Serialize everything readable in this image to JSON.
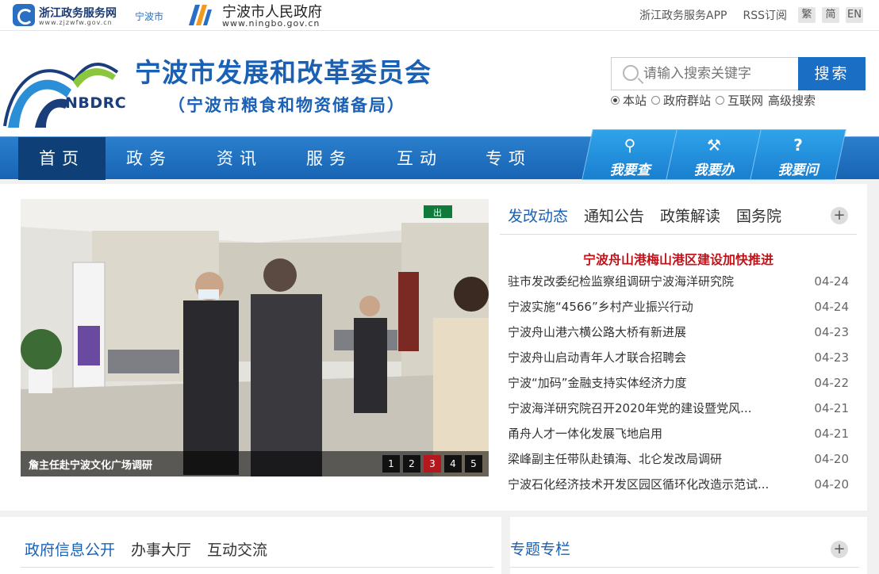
{
  "topbar": {
    "zj_title": "浙江政务服务网",
    "zj_url": "www.zjzwfw.gov.cn",
    "zj_city": "宁波市",
    "nb_title": "宁波市人民政府",
    "nb_url": "www.ningbo.gov.cn",
    "links": [
      "浙江政务服务APP",
      "RSS订阅"
    ],
    "langs": [
      "繁",
      "简",
      "EN"
    ]
  },
  "header": {
    "brand": "NBDRC",
    "title": "宁波市发展和改革委员会",
    "subtitle": "（宁波市粮食和物资储备局）",
    "search_placeholder": "请输入搜索关键字",
    "search_button": "搜索",
    "search_options": [
      "本站",
      "政府群站",
      "互联网"
    ],
    "advanced": "高级搜索"
  },
  "nav": {
    "items": [
      "首页",
      "政务",
      "资讯",
      "服务",
      "互动",
      "专项"
    ],
    "quick": [
      {
        "label": "我要查",
        "icon": "search-icon",
        "glyph": "🔍"
      },
      {
        "label": "我要办",
        "icon": "worker-icon",
        "glyph": "⚒"
      },
      {
        "label": "我要问",
        "icon": "question-icon",
        "glyph": "?"
      }
    ]
  },
  "slider": {
    "caption": "詹主任赴宁波文化广场调研",
    "pages": [
      "1",
      "2",
      "3",
      "4",
      "5"
    ],
    "active_page": "3",
    "exit_sign": "出"
  },
  "news": {
    "tabs": [
      "发改动态",
      "通知公告",
      "政策解读",
      "国务院"
    ],
    "more": "+",
    "headline": "宁波舟山港梅山港区建设加快推进",
    "items": [
      {
        "title": "驻市发改委纪检监察组调研宁波海洋研究院",
        "date": "04-24"
      },
      {
        "title": "宁波实施“4566”乡村产业振兴行动",
        "date": "04-24"
      },
      {
        "title": "宁波舟山港六横公路大桥有新进展",
        "date": "04-23"
      },
      {
        "title": "宁波舟山启动青年人才联合招聘会",
        "date": "04-23"
      },
      {
        "title": "宁波“加码”金融支持实体经济力度",
        "date": "04-22"
      },
      {
        "title": "宁波海洋研究院召开2020年党的建设暨党风...",
        "date": "04-21"
      },
      {
        "title": "甬舟人才一体化发展飞地启用",
        "date": "04-21"
      },
      {
        "title": "梁峰副主任带队赴镇海、北仑发改局调研",
        "date": "04-20"
      },
      {
        "title": "宁波石化经济技术开发区园区循环化改造示范试...",
        "date": "04-20"
      }
    ]
  },
  "bottom": {
    "left_tabs": [
      "政府信息公开",
      "办事大厅",
      "互动交流"
    ],
    "right_tab": "专题专栏",
    "more": "+"
  }
}
